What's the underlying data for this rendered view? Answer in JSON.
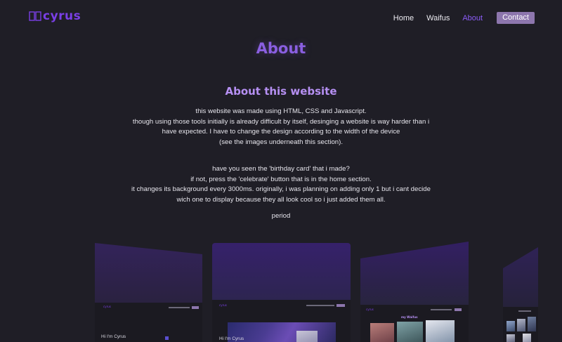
{
  "header": {
    "logo_text": "cyrus",
    "nav": [
      {
        "label": "Home",
        "active": false
      },
      {
        "label": "Waifus",
        "active": false
      },
      {
        "label": "About",
        "active": true
      }
    ],
    "contact_label": "Contact"
  },
  "main": {
    "page_title": "About",
    "section_title": "About this website",
    "paragraph1": [
      "this website was made using HTML, CSS and Javascript.",
      "though using those tools initially is already difficult by itself, desinging a website is way harder than i have expected. I have to change the design according to the width of the device",
      "(see the images underneath this section)."
    ],
    "paragraph2": [
      "have you seen the 'birthday card' that i made?",
      "if not, press the 'celebrate' button that is in the home section.",
      "it changes its background every 3000ms. originally, i was planning on adding only 1 but i cant decide wich one to display because they all look cool so i just added them all."
    ],
    "paragraph3": "period"
  },
  "previews": {
    "card1_heading": "Hi I'm Cyrus",
    "card2_heading": "Hi I'm Cyrus",
    "card3_heading": "my Waifus"
  },
  "colors": {
    "background": "#1f1e26",
    "accent": "#7a3fe6",
    "title": "#8a5fe0",
    "subtitle": "#b690f3",
    "contact_button": "#8d76ad"
  }
}
